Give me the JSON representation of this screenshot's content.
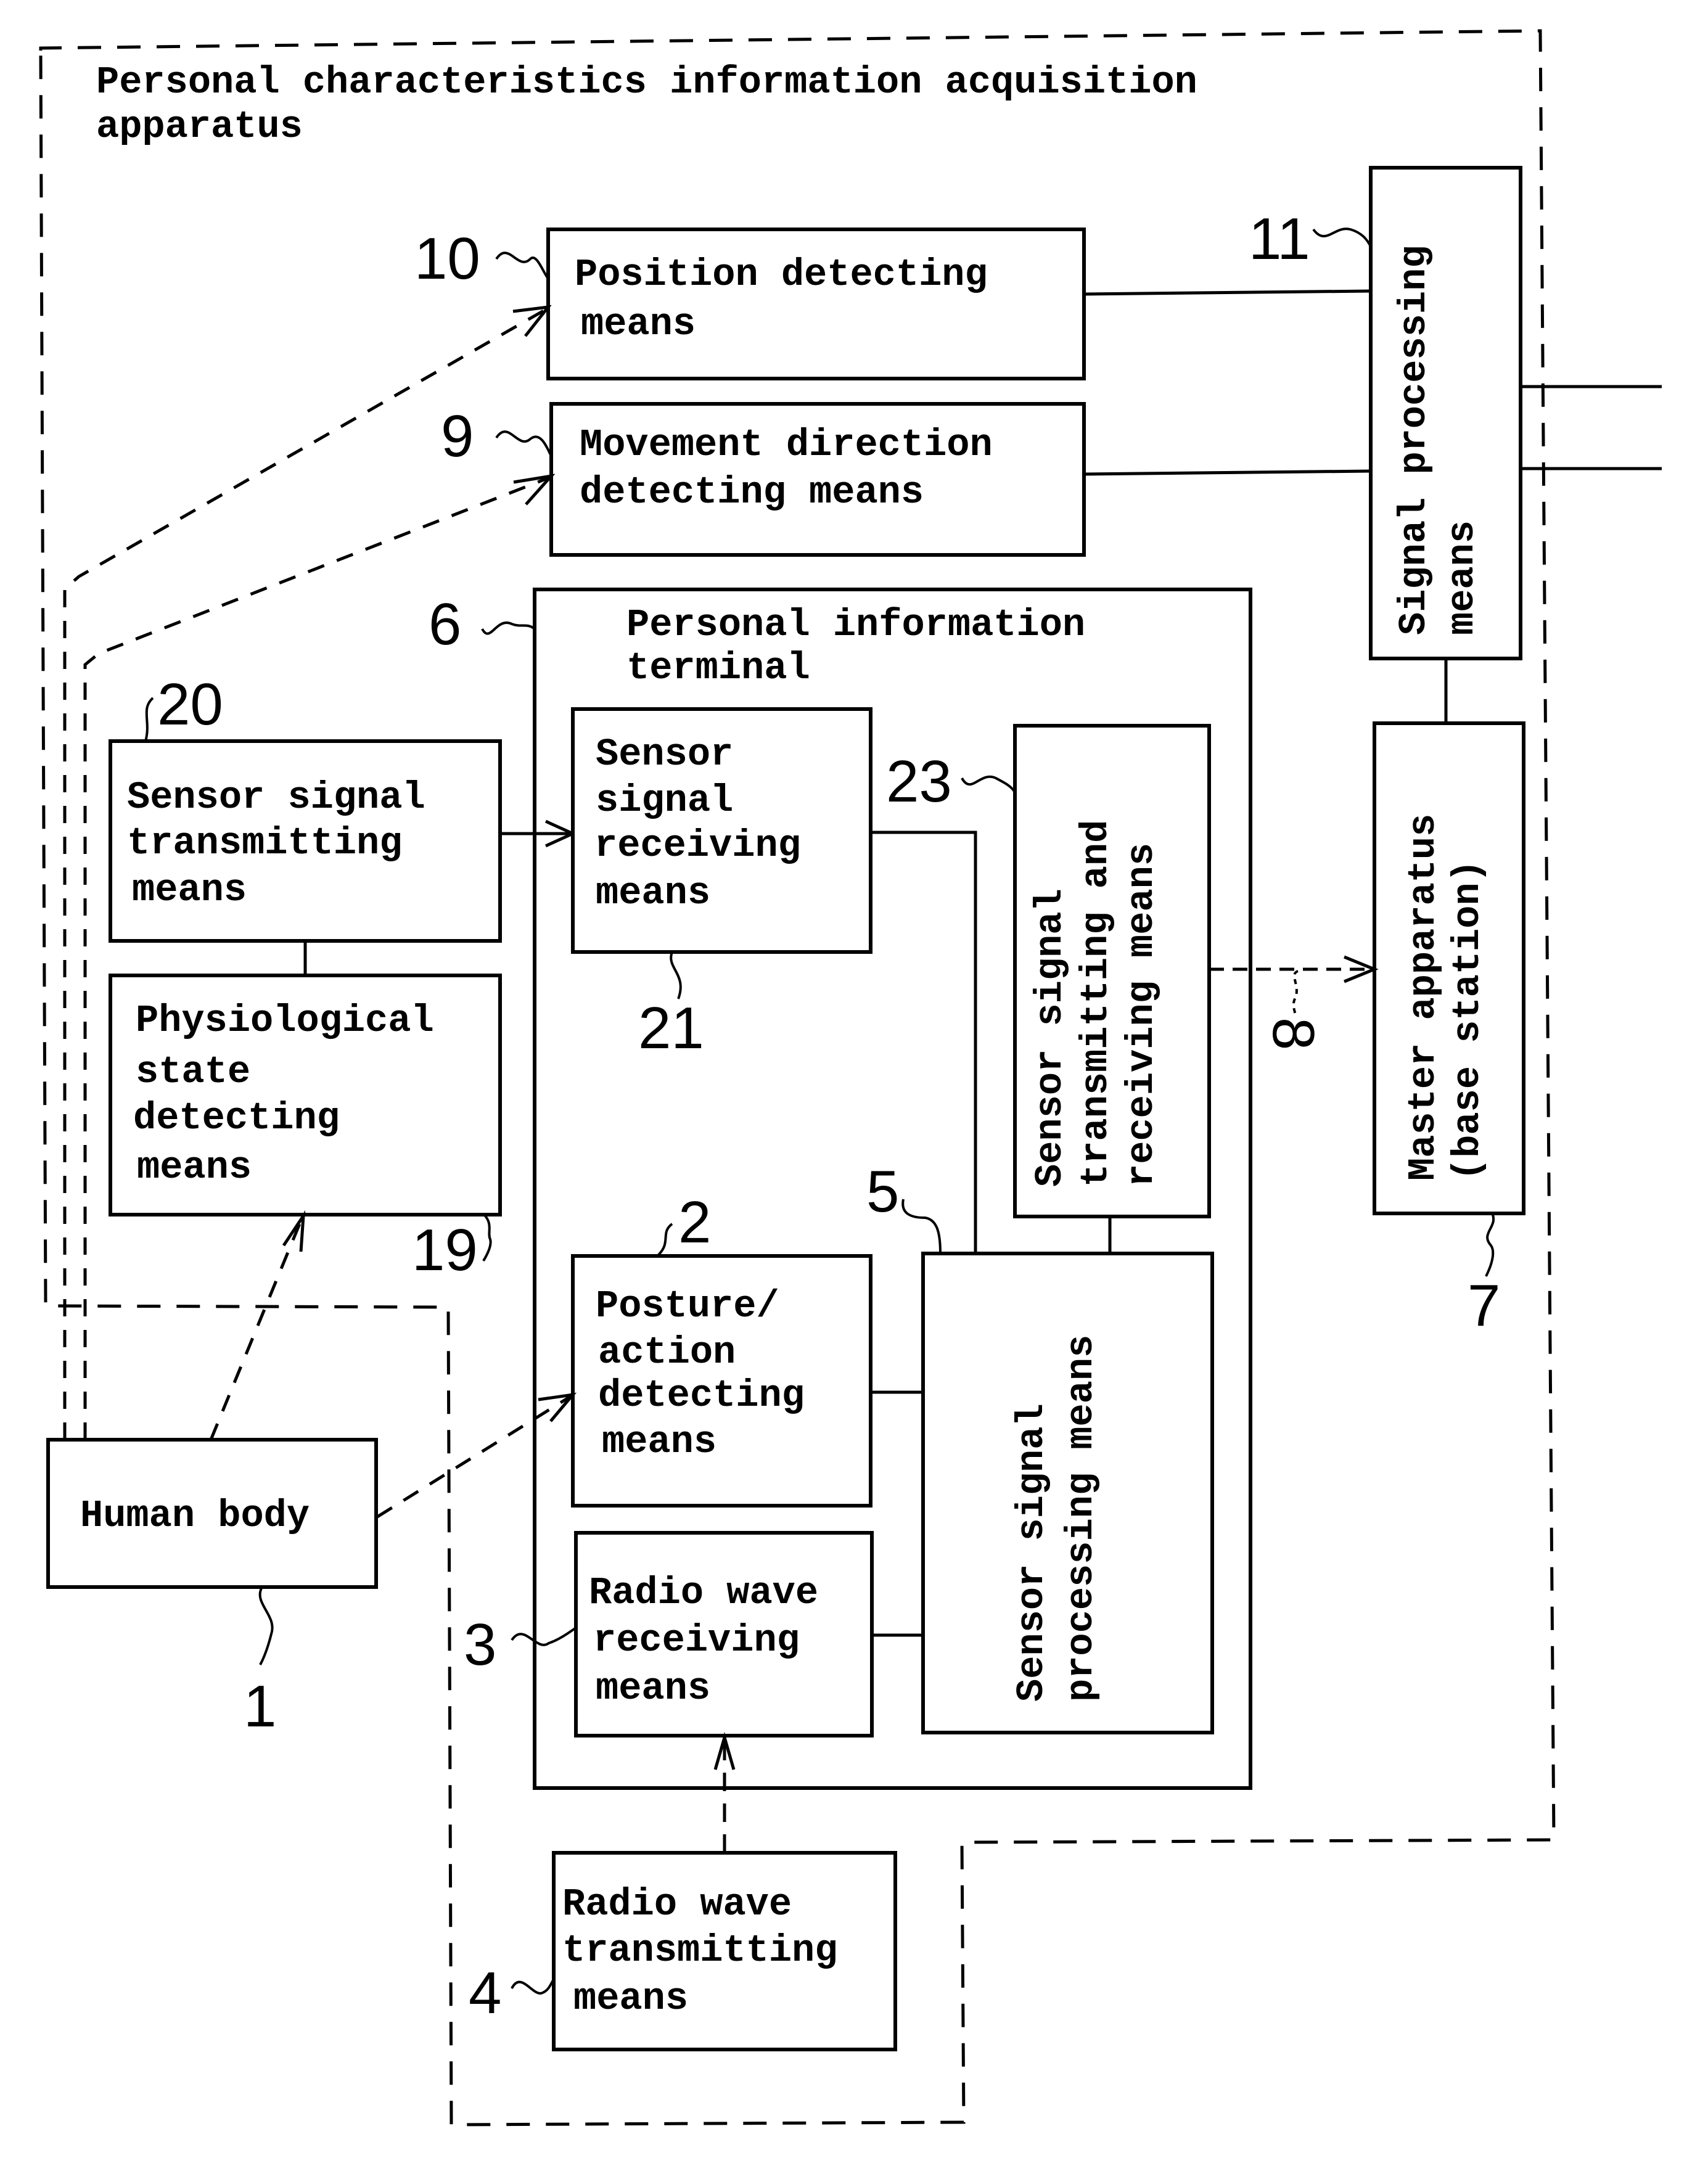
{
  "title": {
    "line1": "Personal characteristics information acquisition",
    "line2": "apparatus"
  },
  "blocks": {
    "position": {
      "ref": "10",
      "lines": [
        "Position detecting",
        "means"
      ]
    },
    "movement": {
      "ref": "9",
      "lines": [
        "Movement direction",
        "detecting means"
      ]
    },
    "signal_processing": {
      "ref": "11",
      "lines": [
        "Signal processing",
        "means"
      ]
    },
    "terminal": {
      "ref": "6",
      "lines": [
        "Personal information",
        "terminal"
      ]
    },
    "sensor_tx": {
      "ref": "20",
      "lines": [
        "Sensor signal",
        "transmitting",
        "means"
      ]
    },
    "physiological": {
      "ref": "19",
      "lines": [
        "Physiological",
        "state",
        "detecting",
        "means"
      ]
    },
    "sensor_rx": {
      "ref": "21",
      "lines": [
        "Sensor",
        "signal",
        "receiving",
        "means"
      ]
    },
    "sensor_txrx": {
      "ref": "23",
      "lines": [
        "Sensor signal",
        "transmitting and",
        "receiving means"
      ]
    },
    "master": {
      "ref": "7",
      "lines": [
        "Master apparatus",
        "(base station)"
      ]
    },
    "posture": {
      "ref": "2",
      "lines": [
        "Posture/",
        "action",
        "detecting",
        "means"
      ]
    },
    "radio_rx": {
      "ref": "3",
      "lines": [
        "Radio wave",
        "receiving",
        "means"
      ]
    },
    "sensor_proc": {
      "ref": "5",
      "lines": [
        "Sensor signal",
        "processing means"
      ]
    },
    "human": {
      "ref": "1",
      "lines": [
        "Human body"
      ]
    },
    "radio_tx": {
      "ref": "4",
      "lines": [
        "Radio wave",
        "transmitting",
        "means"
      ]
    }
  },
  "link_ref": "8"
}
